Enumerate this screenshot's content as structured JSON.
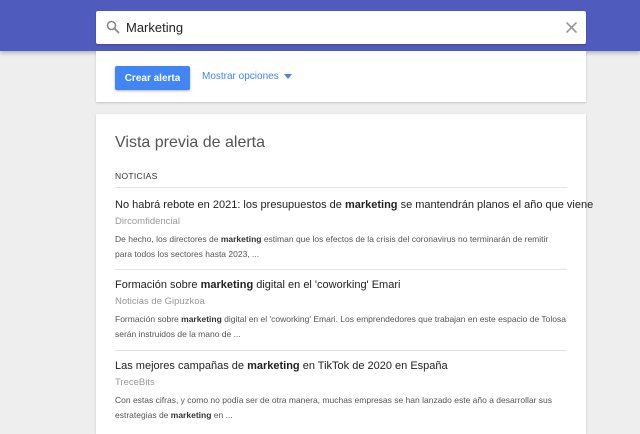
{
  "search": {
    "query": "Marketing"
  },
  "options": {
    "create_label": "Crear alerta",
    "show_options_label": "Mostrar opciones"
  },
  "preview": {
    "title": "Vista previa de alerta",
    "section_label": "NOTICIAS",
    "articles": [
      {
        "title_before": "No habrá rebote en 2021: los presupuestos de ",
        "title_keyword": "marketing",
        "title_after": " se mantendrán planos el año que viene",
        "source": "Dircomfidencial",
        "snippet_before": "De hecho, los directores de ",
        "snippet_keyword": "marketing",
        "snippet_after": " estiman que los efectos de la crisis del coronavirus no terminarán de remitir para todos los sectores hasta 2023, ..."
      },
      {
        "title_before": "Formación sobre ",
        "title_keyword": "marketing",
        "title_after": " digital en el 'coworking' Emari",
        "source": "Noticias de Gipuzkoa",
        "snippet_before": "Formación sobre ",
        "snippet_keyword": "marketing",
        "snippet_after": " digital en el 'coworking' Emari. Los emprendedores que trabajan en este espacio de Tolosa serán instruidos de la mano de ..."
      },
      {
        "title_before": "Las mejores campañas de ",
        "title_keyword": "marketing",
        "title_after": " en TikTok de 2020 en España",
        "source": "TreceBits",
        "snippet_before": "Con estas cifras, y como no podía ser de otra manera, muchas empresas se han lanzado este año a desarrollar sus estrategias de ",
        "snippet_keyword": "marketing",
        "snippet_after": " en ..."
      }
    ]
  },
  "colors": {
    "header": "#4f5bbd",
    "accent": "#4285f4"
  }
}
